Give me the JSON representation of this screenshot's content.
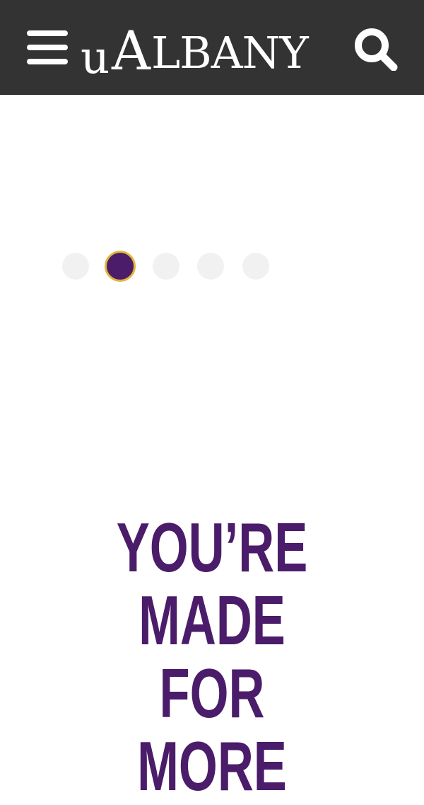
{
  "header": {
    "menu_icon": "hamburger-menu-icon",
    "logo": {
      "u": "u",
      "a": "A",
      "rest": "LBANY",
      "full_text": "UALBANY"
    },
    "search_icon": "search-icon",
    "background_color": "#333333"
  },
  "carousel": {
    "dot_count": 5,
    "active_index": 1,
    "active_color": "#4a1c6a",
    "active_border_color": "#e3b53a",
    "inactive_color": "#f1f1f1"
  },
  "hero": {
    "headline_lines": [
      "YOU’RE",
      "MADE",
      "FOR",
      "MORE"
    ],
    "color": "#4a1c6a"
  }
}
